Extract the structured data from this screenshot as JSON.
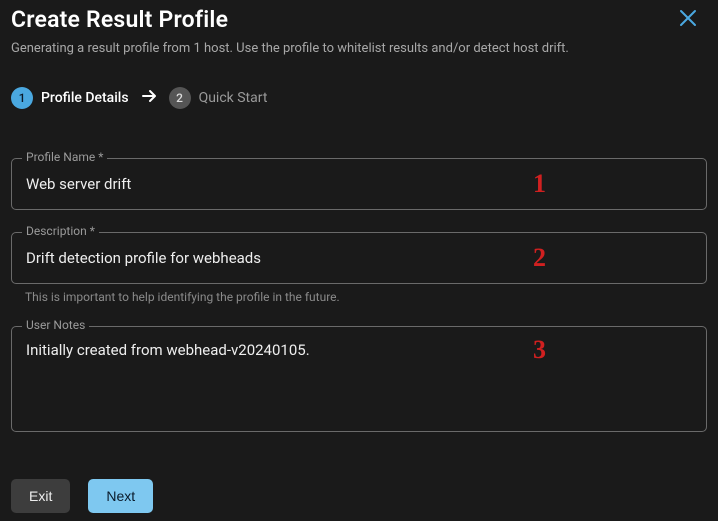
{
  "header": {
    "title": "Create Result Profile",
    "subtitle": "Generating a result profile from 1 host. Use the profile to whitelist results and/or detect host drift."
  },
  "stepper": {
    "steps": [
      {
        "num": "1",
        "label": "Profile Details",
        "active": true
      },
      {
        "num": "2",
        "label": "Quick Start",
        "active": false
      }
    ]
  },
  "fields": {
    "profile_name": {
      "label": "Profile Name *",
      "value": "Web server drift"
    },
    "description": {
      "label": "Description *",
      "value": "Drift detection profile for webheads",
      "helper": "This is important to help identifying the profile in the future."
    },
    "user_notes": {
      "label": "User Notes",
      "value": "Initially created from webhead-v20240105."
    }
  },
  "overlays": {
    "n1": "1",
    "n2": "2",
    "n3": "3"
  },
  "footer": {
    "exit": "Exit",
    "next": "Next"
  }
}
